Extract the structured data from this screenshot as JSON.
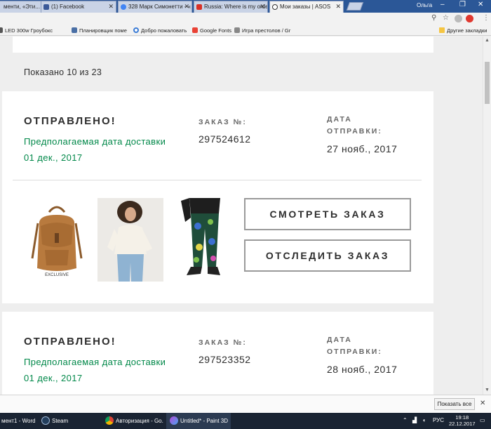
{
  "browser": {
    "tabs": [
      {
        "title": "менти, «Эти..."
      },
      {
        "title": "(1) Facebook"
      },
      {
        "title": "328 Марк Симонетти - «"
      },
      {
        "title": "Russia: Where is my orde"
      },
      {
        "title": "Мои заказы | ASOS"
      }
    ],
    "user_name": "Ольга",
    "window_controls": {
      "minimize": "–",
      "restore": "❐",
      "close": "✕"
    },
    "toolbar_icons": {
      "zoom": "⚲",
      "star": "☆",
      "menu": "⋮"
    },
    "bookmarks": [
      {
        "label": "LED 300w Гроубокс"
      },
      {
        "label": "Планировщик поме"
      },
      {
        "label": "Добро пожаловать"
      },
      {
        "label": "Google Fonts"
      },
      {
        "label": "Игра престолов / Gr"
      }
    ],
    "other_bookmarks": "Другие закладки"
  },
  "page": {
    "shown_count": "Показано 10 из 23",
    "orders": [
      {
        "status": "ОТПРАВЛЕНО!",
        "eta_label": "Предполагаемая дата доставки",
        "eta_date": "01 дек., 2017",
        "order_label": "ЗАКАЗ №:",
        "order_number": "297524612",
        "ship_label_1": "ДАТА",
        "ship_label_2": "ОТПРАВКИ:",
        "ship_date": "27 нояб., 2017",
        "exclusive": "EXCLUSIVE",
        "view_button": "СМОТРЕТЬ ЗАКАЗ",
        "track_button": "ОТСЛЕДИТЬ ЗАКАЗ"
      },
      {
        "status": "ОТПРАВЛЕНО!",
        "eta_label": "Предполагаемая дата доставки",
        "eta_date": "01 дек., 2017",
        "order_label": "ЗАКАЗ №:",
        "order_number": "297523352",
        "ship_label_1": "ДАТА",
        "ship_label_2": "ОТПРАВКИ:",
        "ship_date": "28 нояб., 2017"
      }
    ],
    "accent_color": "#018849"
  },
  "notification": {
    "show_all": "Показать все",
    "close": "✕"
  },
  "taskbar": {
    "items": [
      {
        "label": "мент1 - Word"
      },
      {
        "label": "Steam"
      },
      {
        "label": "Авторизация - Go..."
      },
      {
        "label": "Untitled* - Paint 3D"
      }
    ],
    "language": "РУС",
    "time": "19:18",
    "date": "22.12.2017"
  }
}
